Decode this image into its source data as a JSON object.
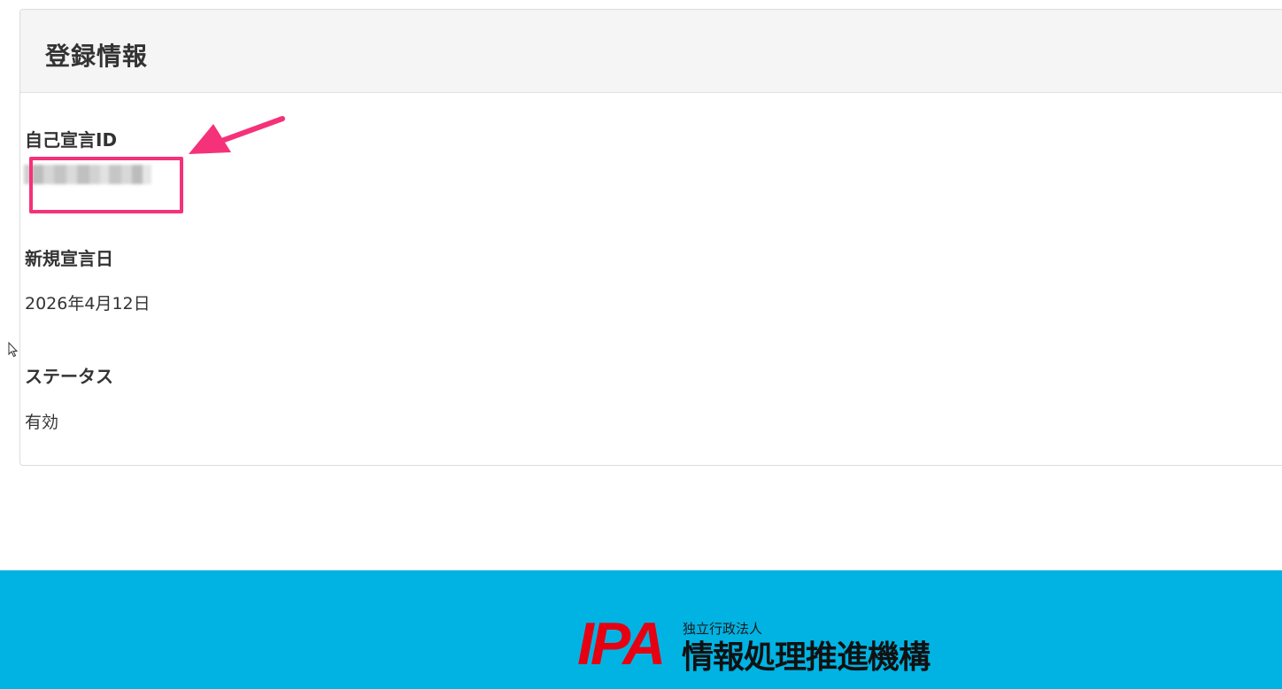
{
  "card": {
    "title": "登録情報"
  },
  "fields": [
    {
      "label": "自己宣言ID",
      "value": ""
    },
    {
      "label": "新規宣言日",
      "value": "2026年4月12日"
    },
    {
      "label": "ステータス",
      "value": "有効"
    }
  ],
  "annotation": {
    "highlight_color": "#f5317a"
  },
  "footer": {
    "background_color": "#00b3e3",
    "logo_text": "IPA",
    "logo_color": "#e60012",
    "org_sub": "独立行政法人",
    "org_name": "情報処理推進機構"
  }
}
